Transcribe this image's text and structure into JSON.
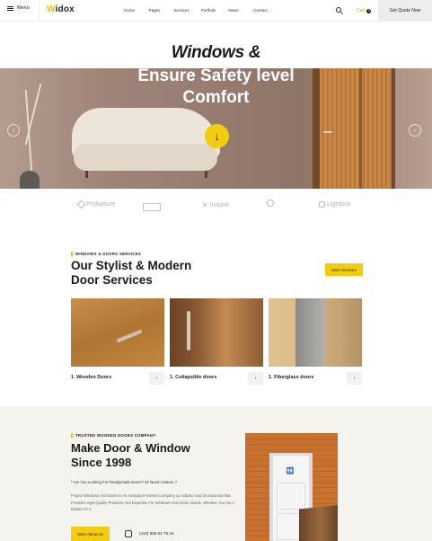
{
  "header": {
    "menu_label": "Menu",
    "logo": "idox",
    "logo_w": "W",
    "nav": [
      "Home",
      "Pages",
      "Services",
      "Portfolio",
      "News",
      "Contact"
    ],
    "cart_label": "Cart",
    "cart_count": "0",
    "quote_label": "Get Quote Now"
  },
  "hero": {
    "line1": "Windows &",
    "line2": "Ensure Safety level",
    "line3": "Comfort",
    "down_glyph": "↓",
    "prev_glyph": "‹",
    "next_glyph": "›"
  },
  "partners": [
    "ProNature",
    "",
    "Inspire",
    "",
    "Lightbox"
  ],
  "services": {
    "tag": "WINDOWS & DOORS SERVICES",
    "title_line1": "Our Stylist & Modern",
    "title_line2": "Door Services",
    "button": "More Services",
    "cards": [
      {
        "label": "1. Wooden Doors",
        "arrow": "›"
      },
      {
        "label": "1. Collapsible doors",
        "arrow": "›"
      },
      {
        "label": "1. Fiberglass doors",
        "arrow": "›"
      }
    ]
  },
  "about": {
    "tag": "TRUSTED WOODEN DOORS COMPANY",
    "title_line1": "Make Door & Window",
    "title_line2": "Since 1998",
    "question": "* Are You Looking For Readymade Doors? Or Need Custom ?",
    "paragraph": "Project Windows And Doors Is An Australian-Owned Company Lo Adipisci Sed Do Eiusmod that Provides High-Quality Products And Expertise For Windows And Doors Needs. Whether You Are A Builder Or A",
    "button": "More About Us",
    "phone": "(410) 555-01 78 44"
  },
  "colors": {
    "accent": "#f2cd0f",
    "about_bg": "#f4f3ee"
  }
}
